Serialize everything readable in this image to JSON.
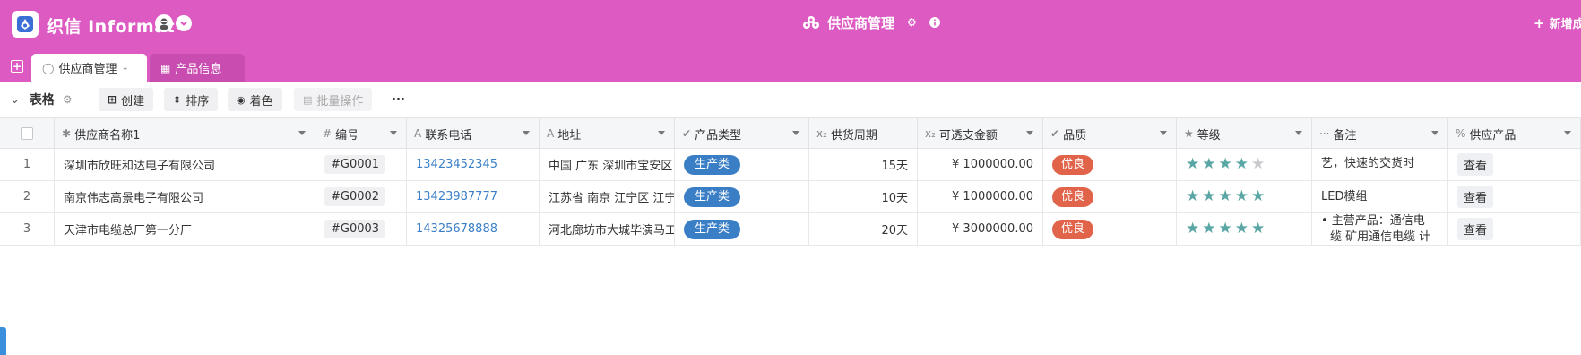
{
  "app": {
    "logo_text": "织信 Informat",
    "page_title": "供应商管理",
    "new_label": "新增成"
  },
  "tabs": [
    {
      "label": "供应商管理",
      "active": true
    },
    {
      "label": "产品信息",
      "active": false
    }
  ],
  "toolbar": {
    "title": "表格",
    "create": "创建",
    "sort": "排序",
    "color": "着色",
    "batch": "批量操作",
    "more": "···"
  },
  "columns": [
    {
      "label": "供应商名称1",
      "icon": "asterisk-icon",
      "glyph": "✱"
    },
    {
      "label": "编号",
      "icon": "hash-icon",
      "glyph": "#"
    },
    {
      "label": "联系电话",
      "icon": "text-icon",
      "glyph": "A"
    },
    {
      "label": "地址",
      "icon": "text-icon",
      "glyph": "A"
    },
    {
      "label": "产品类型",
      "icon": "check-circle-icon",
      "glyph": "✔"
    },
    {
      "label": "供货周期",
      "icon": "number-icon",
      "glyph": "x₂"
    },
    {
      "label": "可透支金额",
      "icon": "number-icon",
      "glyph": "x₂"
    },
    {
      "label": "品质",
      "icon": "check-circle-icon",
      "glyph": "✔"
    },
    {
      "label": "等级",
      "icon": "star-icon",
      "glyph": "★"
    },
    {
      "label": "备注",
      "icon": "more-icon",
      "glyph": "···"
    },
    {
      "label": "供应产品",
      "icon": "link-icon",
      "glyph": "🔗"
    }
  ],
  "rows": [
    {
      "num": "1",
      "name": "深圳市欣旺和达电子有限公司",
      "code": "#G0001",
      "phone": "13423452345",
      "address": "中国 广东 深圳市宝安区",
      "type": "生产类",
      "cycle": "15天",
      "amount": "¥ 1000000.00",
      "quality": "优良",
      "rating": 4,
      "remark_lines": [
        "艺，快速的交货时"
      ],
      "product": "查看"
    },
    {
      "num": "2",
      "name": "南京伟志高景电子有限公司",
      "code": "#G0002",
      "phone": "13423987777",
      "address": "江苏省 南京 江宁区 江宁",
      "type": "生产类",
      "cycle": "10天",
      "amount": "¥ 1000000.00",
      "quality": "优良",
      "rating": 5,
      "remark_lines": [
        "LED模组"
      ],
      "product": "查看"
    },
    {
      "num": "3",
      "name": "天津市电缆总厂第一分厂",
      "code": "#G0003",
      "phone": "14325678888",
      "address": "河北廊坊市大城毕演马工",
      "type": "生产类",
      "cycle": "20天",
      "amount": "¥ 3000000.00",
      "quality": "优良",
      "rating": 5,
      "remark_lines": [
        "• 主营产品：通信电",
        "缆 矿用通信电缆 计"
      ],
      "product": "查看"
    }
  ],
  "colors": {
    "header": "#dd5ac2",
    "tab_inactive": "#c94db0",
    "pill_type": "#3a7ec6",
    "pill_quality": "#e1644a",
    "star_on": "#5aa6a5",
    "link": "#3a7fc8"
  }
}
